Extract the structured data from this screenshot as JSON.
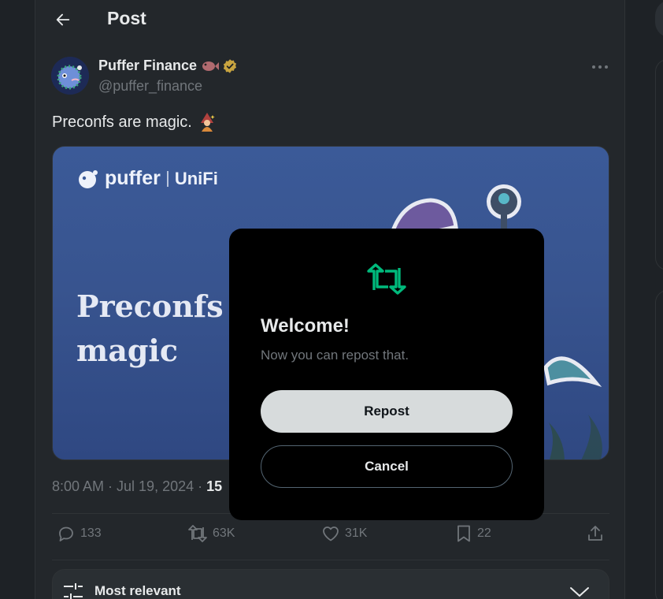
{
  "header": {
    "title": "Post"
  },
  "author": {
    "name": "Puffer Finance",
    "handle": "@puffer_finance"
  },
  "post": {
    "text": "Preconfs are magic.",
    "media": {
      "brand": "puffer",
      "partner": "UniFi",
      "headline_line1": "Preconfs a",
      "headline_line2": "magic"
    },
    "time": "8:00 AM · Jul 19, 2024 · ",
    "views_partial": "15"
  },
  "actions": {
    "replies": "133",
    "reposts": "63K",
    "likes": "31K",
    "bookmarks": "22"
  },
  "sort": {
    "label": "Most relevant"
  },
  "modal": {
    "title": "Welcome!",
    "subtitle": "Now you can repost that.",
    "primary_label": "Repost",
    "secondary_label": "Cancel"
  },
  "colors": {
    "accent_green": "#00ba7c",
    "verified_gold": "#c8a440",
    "background": "#1e2226"
  }
}
